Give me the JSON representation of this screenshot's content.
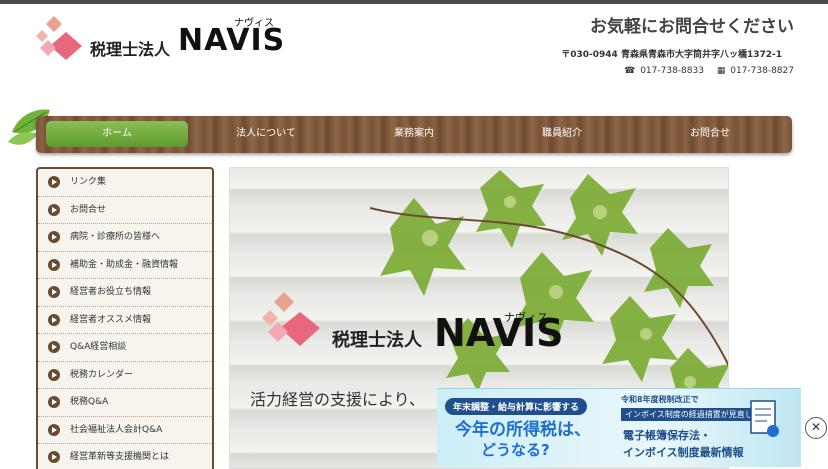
{
  "header": {
    "company_name": "税理士法人",
    "brand": "NAVIS",
    "brand_kana": "ナヴィス",
    "contact_title": "お気軽にお問合せください",
    "address": "〒030-0944 青森県青森市大字筒井字八ッ橋1372-1",
    "tel": "017-738-8833",
    "fax": "017-738-8827",
    "tel_icon": "phone-icon",
    "fax_icon": "fax-icon"
  },
  "nav": {
    "items": [
      {
        "label": "ホーム",
        "active": true
      },
      {
        "label": "法人について"
      },
      {
        "label": "業務案内"
      },
      {
        "label": "職員紹介"
      },
      {
        "label": "お問合せ"
      }
    ],
    "active_color": "#6aa83a",
    "bar_color": "#7a5338"
  },
  "sidebar": {
    "items": [
      "リンク集",
      "お問合せ",
      "病院・診療所の皆様へ",
      "補助金・助成金・融資情報",
      "経営者お役立ち情報",
      "経営者オススメ情報",
      "Q&A経営相談",
      "税務カレンダー",
      "税務Q&A",
      "社会福祉法人会計Q&A",
      "経営革新等支援機関とは"
    ]
  },
  "hero": {
    "company_name": "税理士法人",
    "brand": "NAVIS",
    "brand_kana": "ナヴィス",
    "tagline": "活力経営の支援により、"
  },
  "banner": {
    "pill": "年末調整・給与計算に影響する",
    "headline1": "今年の所得税は、",
    "headline2": "どうなる?",
    "right_line1": "令和8年度税制改正で",
    "right_line2": "インボイス制度の経過措置が見直し",
    "right_line3": "電子帳簿保存法・",
    "right_line4": "インボイス制度最新情報",
    "close_icon": "close-icon"
  }
}
